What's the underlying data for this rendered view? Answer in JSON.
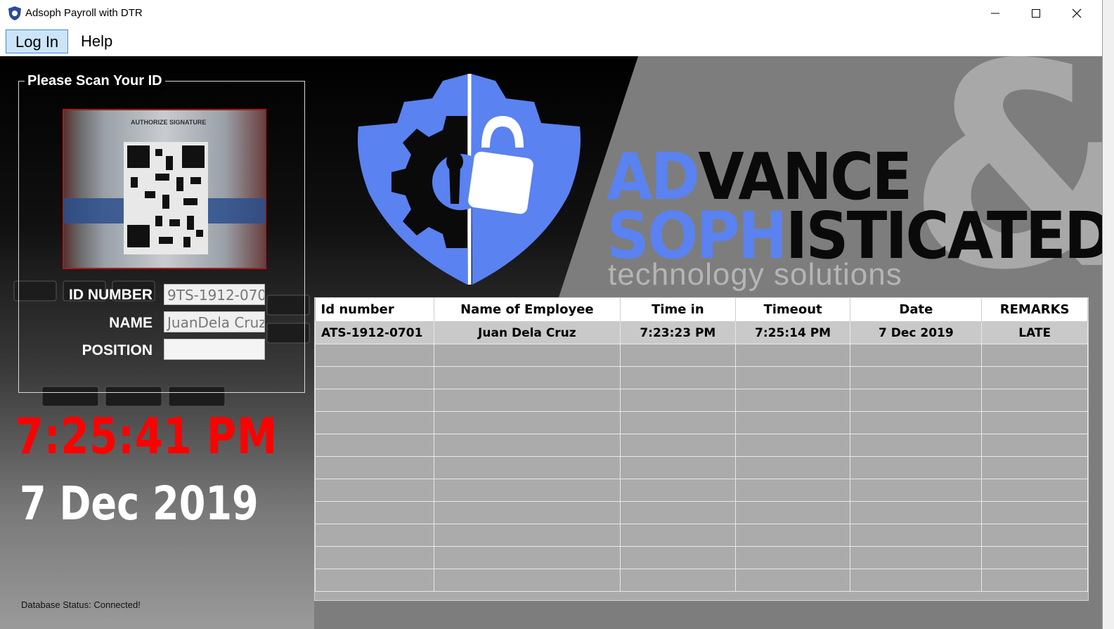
{
  "window": {
    "title": "Adsoph Payroll with DTR"
  },
  "menu": {
    "items": [
      {
        "label": "Log In"
      },
      {
        "label": "Help"
      }
    ]
  },
  "scan": {
    "legend": "Please Scan Your ID",
    "camera_caption": "AUTHORIZE SIGNATURE",
    "fields": [
      {
        "label": "ID NUMBER",
        "value": "9TS-1912-070"
      },
      {
        "label": "NAME",
        "value": "JuanDela Cruz"
      },
      {
        "label": "POSITION",
        "value": ""
      }
    ]
  },
  "clock": {
    "time": "7:25:41 PM",
    "date": "7 Dec 2019"
  },
  "status": {
    "text": "Database Status: Connected!"
  },
  "brand": {
    "line1_blue": "AD",
    "line1_black": "VANCE",
    "line2_blue": "SOPH",
    "line2_black": "ISTICATED",
    "tagline": "technology solutions",
    "ampersand": "&"
  },
  "table": {
    "columns": [
      "Id number",
      "Name of Employee",
      "Time in",
      "Timeout",
      "Date",
      "REMARKS"
    ],
    "rows": [
      [
        "ATS-1912-0701",
        "Juan Dela Cruz",
        "7:23:23 PM",
        "7:25:14 PM",
        "7 Dec 2019",
        "LATE"
      ]
    ],
    "empty_rows": 11
  },
  "colors": {
    "accent_blue": "#5a82f0",
    "clock_red": "#ff0000",
    "camera_border": "#b01818"
  }
}
